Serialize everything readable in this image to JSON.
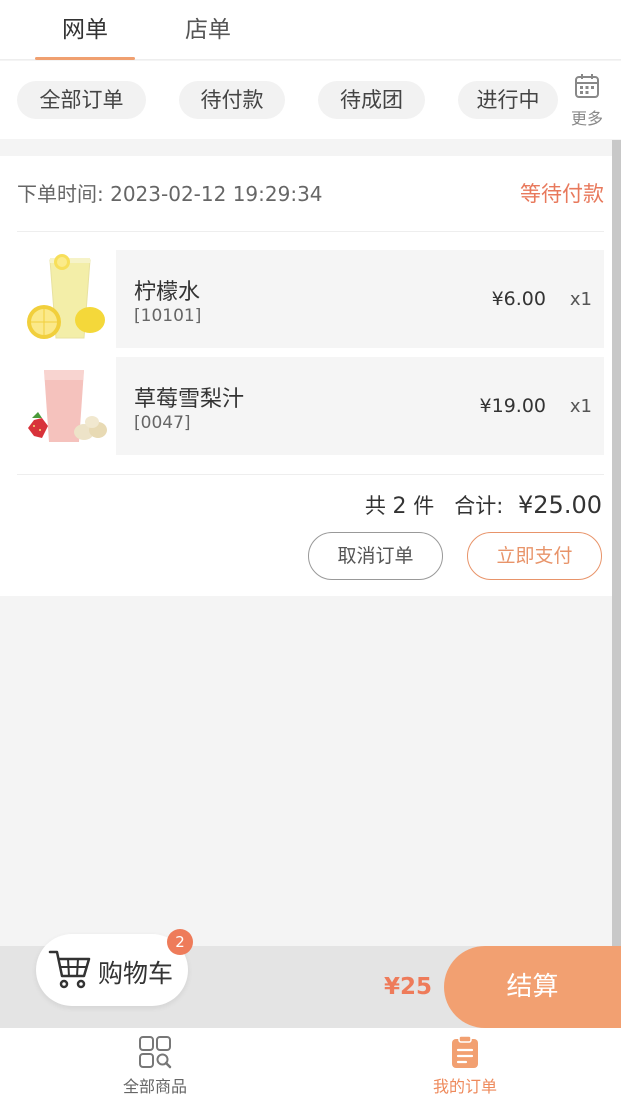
{
  "top_tabs": [
    {
      "label": "网单",
      "active": true
    },
    {
      "label": "店单",
      "active": false
    }
  ],
  "filters": {
    "chips": [
      "全部订单",
      "待付款",
      "待成团",
      "进行中"
    ],
    "more_label": "更多",
    "more_icon": "calendar-icon"
  },
  "order": {
    "time_label": "下单时间:",
    "time_value": "2023-02-12 19:29:34",
    "status": "等待付款",
    "items": [
      {
        "name": "柠檬水",
        "code": "[10101]",
        "price": "¥6.00",
        "qty": "x1",
        "thumb": "lemonade-image"
      },
      {
        "name": "草莓雪梨汁",
        "code": "[0047]",
        "price": "¥19.00",
        "qty": "x1",
        "thumb": "strawberry-pear-juice-image"
      }
    ],
    "summary": {
      "count_prefix": "共",
      "count": "2",
      "count_suffix": "件",
      "total_label": "合计:",
      "total_value": "¥25.00"
    },
    "buttons": {
      "cancel": "取消订单",
      "pay": "立即支付"
    }
  },
  "cart": {
    "label": "购物车",
    "badge": "2",
    "total": "¥25",
    "checkout": "结算",
    "icon": "cart-icon"
  },
  "bottom_nav": [
    {
      "label": "全部商品",
      "icon": "grid-search-icon",
      "active": false
    },
    {
      "label": "我的订单",
      "icon": "clipboard-icon",
      "active": true
    }
  ],
  "colors": {
    "accent": "#f2a071",
    "status_red": "#e8795c",
    "tab_underline": "#f0a070"
  }
}
